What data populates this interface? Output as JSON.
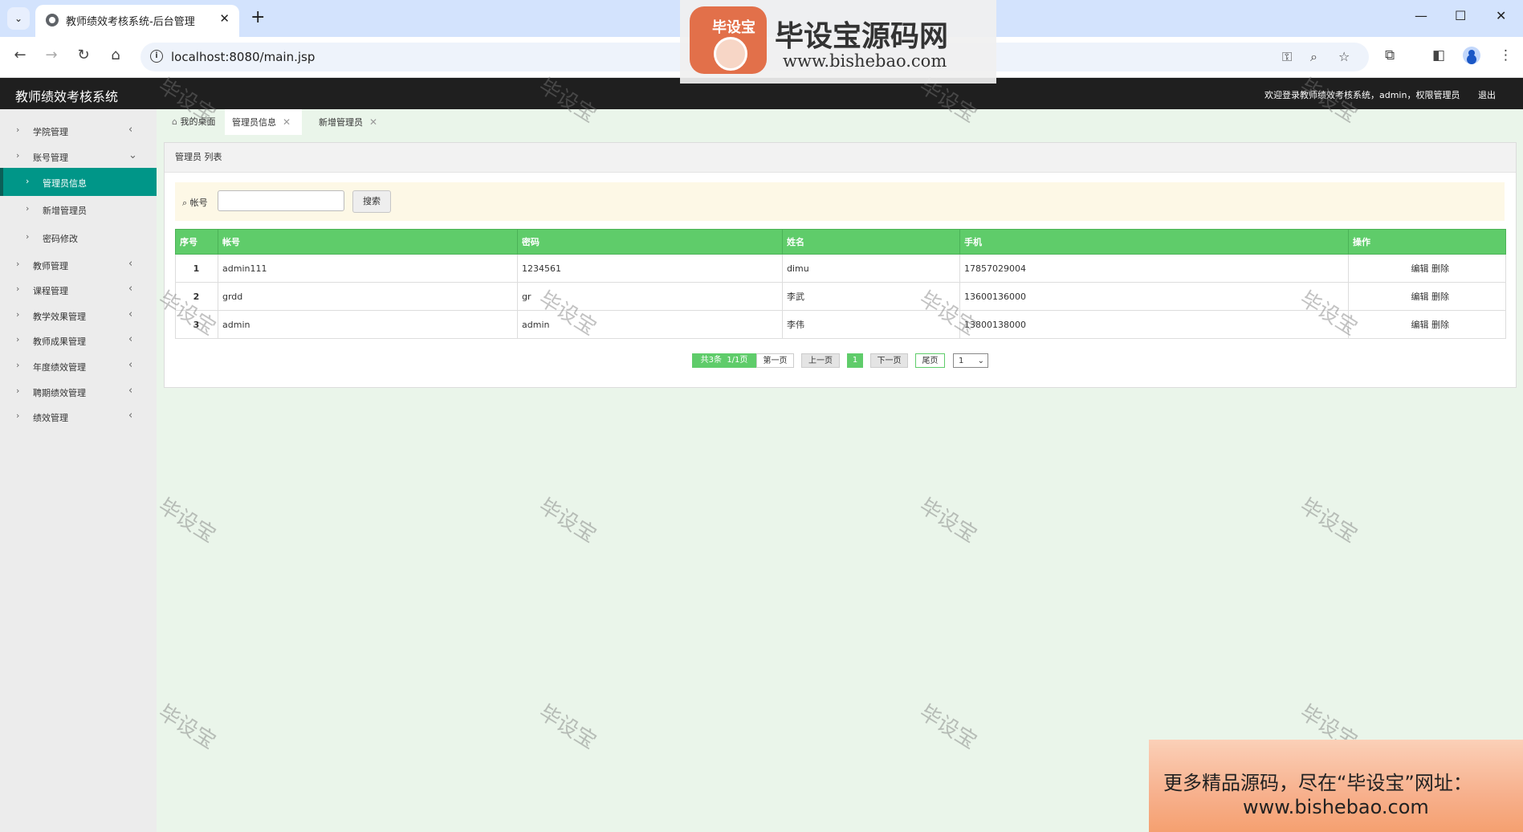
{
  "browser": {
    "tab_title": "教师绩效考核系统-后台管理",
    "url": "localhost:8080/main.jsp",
    "new_tab": "+",
    "close": "✕"
  },
  "header": {
    "app_title": "教师绩效考核系统",
    "welcome": "欢迎登录教师绩效考核系统，admin，权限管理员",
    "logout": "退出"
  },
  "sidebar": {
    "items": [
      {
        "label": "学院管理"
      },
      {
        "label": "账号管理"
      },
      {
        "label": "管理员信息"
      },
      {
        "label": "新增管理员"
      },
      {
        "label": "密码修改"
      },
      {
        "label": "教师管理"
      },
      {
        "label": "课程管理"
      },
      {
        "label": "教学效果管理"
      },
      {
        "label": "教师成果管理"
      },
      {
        "label": "年度绩效管理"
      },
      {
        "label": "聘期绩效管理"
      },
      {
        "label": "绩效管理"
      }
    ]
  },
  "page_tabs": [
    {
      "label": "我的桌面"
    },
    {
      "label": "管理员信息"
    },
    {
      "label": "新增管理员"
    }
  ],
  "panel": {
    "title": "管理员 列表",
    "search_label": "帐号",
    "search_value": "",
    "search_button": "搜索"
  },
  "table": {
    "headers": [
      "序号",
      "帐号",
      "密码",
      "姓名",
      "手机",
      "操作"
    ],
    "rows": [
      {
        "no": "1",
        "account": "admin111",
        "password": "1234561",
        "name": "dimu",
        "phone": "17857029004",
        "edit": "编辑",
        "delete": "删除"
      },
      {
        "no": "2",
        "account": "grdd",
        "password": "gr",
        "name": "李武",
        "phone": "13600136000",
        "edit": "编辑",
        "delete": "删除"
      },
      {
        "no": "3",
        "account": "admin",
        "password": "admin",
        "name": "李伟",
        "phone": "13800138000",
        "edit": "编辑",
        "delete": "删除"
      }
    ]
  },
  "pagination": {
    "total": "共3条",
    "pages": "1/1页",
    "first": "第一页",
    "prev": "上一页",
    "current": "1",
    "next": "下一页",
    "last": "尾页",
    "select_value": "1"
  },
  "watermark": {
    "text": "毕设宝",
    "logo_badge": "毕设宝",
    "brand": "毕设宝源码网",
    "site": "www.bishebao.com",
    "promo_line1": "更多精品源码，尽在“毕设宝”网址：",
    "promo_line2": "www.bishebao.com"
  }
}
